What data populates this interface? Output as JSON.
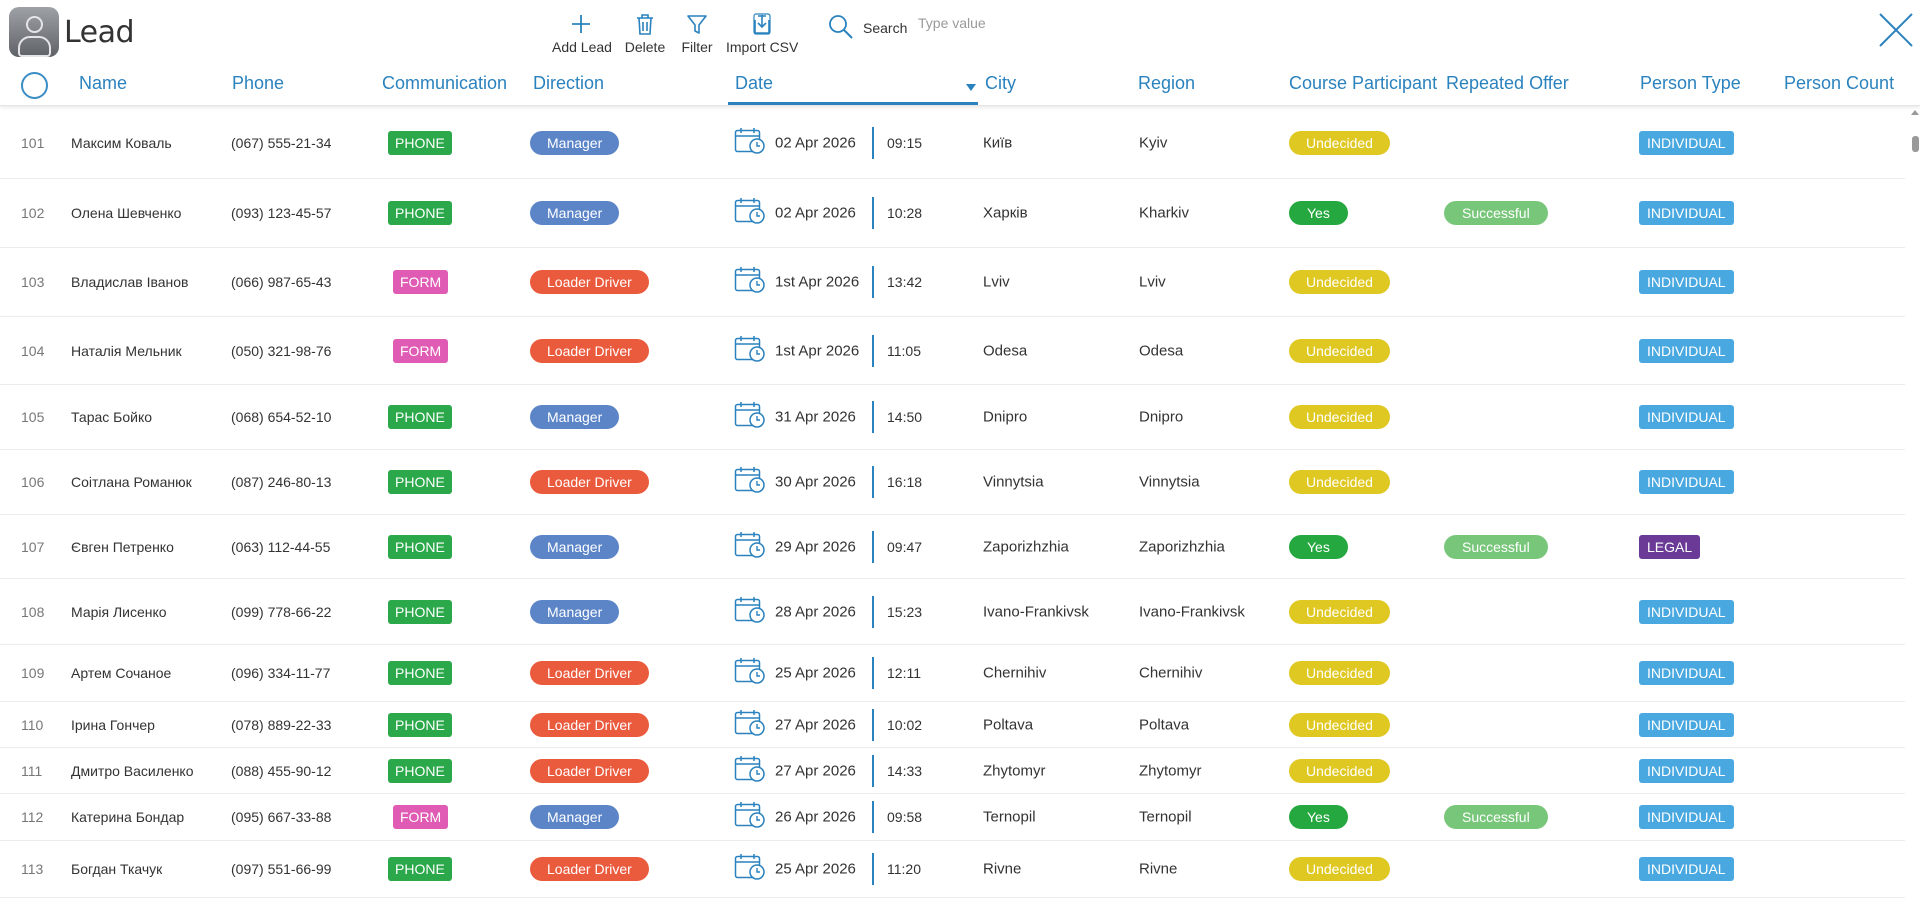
{
  "header": {
    "title": "Lead",
    "toolbar": {
      "add": "Add Lead",
      "delete": "Delete",
      "filter": "Filter",
      "import": "Import CSV"
    },
    "search_label": "Search",
    "search_placeholder": "Type value"
  },
  "columns": {
    "name": "Name",
    "phone": "Phone",
    "communication": "Communication",
    "direction": "Direction",
    "date": "Date",
    "city": "City",
    "region": "Region",
    "course": "Course Participant",
    "repeated": "Repeated Offer",
    "person_type": "Person Type",
    "person_count": "Person Count"
  },
  "colors": {
    "accent": "#2a82be",
    "phone": "#2aa84a",
    "form": "#e05bb4",
    "manager": "#5c85c8",
    "loader": "#ea5a3d",
    "undecided": "#e0c823",
    "yes": "#25a83f",
    "successful": "#78c67a",
    "individual": "#4aa8e0",
    "legal": "#6a3a96"
  },
  "rows": [
    {
      "num": "101",
      "name": "Максим Коваль",
      "phone": "(067) 555-21-34",
      "comm": "PHONE",
      "dir": "Manager",
      "date": "02 Apr 2026",
      "time": "09:15",
      "city": "Київ",
      "region": "Kyiv",
      "course": "Undecided",
      "repeat": "",
      "ptype": "INDIVIDUAL"
    },
    {
      "num": "102",
      "name": "Олена Шевченко",
      "phone": "(093) 123-45-57",
      "comm": "PHONE",
      "dir": "Manager",
      "date": "02 Apr 2026",
      "time": "10:28",
      "city": "Харків",
      "region": "Kharkiv",
      "course": "Yes",
      "repeat": "Successful",
      "ptype": "INDIVIDUAL"
    },
    {
      "num": "103",
      "name": "Владислав Іванов",
      "phone": "(066) 987-65-43",
      "comm": "FORM",
      "dir": "Loader Driver",
      "date": "1st Apr 2026",
      "time": "13:42",
      "city": "Lviv",
      "region": "Lviv",
      "course": "Undecided",
      "repeat": "",
      "ptype": "INDIVIDUAL"
    },
    {
      "num": "104",
      "name": "Наталія Мельник",
      "phone": "(050) 321-98-76",
      "comm": "FORM",
      "dir": "Loader Driver",
      "date": "1st Apr 2026",
      "time": "11:05",
      "city": "Odesa",
      "region": "Odesa",
      "course": "Undecided",
      "repeat": "",
      "ptype": "INDIVIDUAL"
    },
    {
      "num": "105",
      "name": "Тарас Бойко",
      "phone": "(068) 654-52-10",
      "comm": "PHONE",
      "dir": "Manager",
      "date": "31 Apr 2026",
      "time": "14:50",
      "city": "Dnipro",
      "region": "Dnipro",
      "course": "Undecided",
      "repeat": "",
      "ptype": "INDIVIDUAL"
    },
    {
      "num": "106",
      "name": "Соітлана Романюк",
      "phone": "(087) 246-80-13",
      "comm": "PHONE",
      "dir": "Loader Driver",
      "date": "30 Apr 2026",
      "time": "16:18",
      "city": "Vinnytsia",
      "region": "Vinnytsia",
      "course": "Undecided",
      "repeat": "",
      "ptype": "INDIVIDUAL"
    },
    {
      "num": "107",
      "name": "Євген Петренко",
      "phone": "(063) 112-44-55",
      "comm": "PHONE",
      "dir": "Manager",
      "date": "29 Apr 2026",
      "time": "09:47",
      "city": "Zaporizhzhia",
      "region": "Zaporizhzhia",
      "course": "Yes",
      "repeat": "Successful",
      "ptype": "LEGAL"
    },
    {
      "num": "108",
      "name": "Марія Лисенко",
      "phone": "(099) 778-66-22",
      "comm": "PHONE",
      "dir": "Manager",
      "date": "28 Apr 2026",
      "time": "15:23",
      "city": "Ivano-Frankivsk",
      "region": "Ivano-Frankivsk",
      "course": "Undecided",
      "repeat": "",
      "ptype": "INDIVIDUAL"
    },
    {
      "num": "109",
      "name": "Артем Сочаное",
      "phone": "(096) 334-11-77",
      "comm": "PHONE",
      "dir": "Loader Driver",
      "date": "25 Apr 2026",
      "time": "12:11",
      "city": "Chernihiv",
      "region": "Chernihiv",
      "course": "Undecided",
      "repeat": "",
      "ptype": "INDIVIDUAL"
    },
    {
      "num": "110",
      "name": "Ірина Гончер",
      "phone": "(078) 889-22-33",
      "comm": "PHONE",
      "dir": "Loader Driver",
      "date": "27 Apr 2026",
      "time": "10:02",
      "city": "Poltava",
      "region": "Poltava",
      "course": "Undecided",
      "repeat": "",
      "ptype": "INDIVIDUAL"
    },
    {
      "num": "111",
      "name": "Дмитро Василенко",
      "phone": "(088) 455-90-12",
      "comm": "PHONE",
      "dir": "Loader Driver",
      "date": "27 Apr 2026",
      "time": "14:33",
      "city": "Zhytomyr",
      "region": "Zhytomyr",
      "course": "Undecided",
      "repeat": "",
      "ptype": "INDIVIDUAL"
    },
    {
      "num": "112",
      "name": "Катерина Бондар",
      "phone": "(095) 667-33-88",
      "comm": "FORM",
      "dir": "Manager",
      "date": "26 Apr 2026",
      "time": "09:58",
      "city": "Ternopil",
      "region": "Ternopil",
      "course": "Yes",
      "repeat": "Successful",
      "ptype": "INDIVIDUAL"
    },
    {
      "num": "113",
      "name": "Богдан Ткачук",
      "phone": "(097) 551-66-99",
      "comm": "PHONE",
      "dir": "Loader Driver",
      "date": "25 Apr 2026",
      "time": "11:20",
      "city": "Rivne",
      "region": "Rivne",
      "course": "Undecided",
      "repeat": "",
      "ptype": "INDIVIDUAL"
    }
  ]
}
